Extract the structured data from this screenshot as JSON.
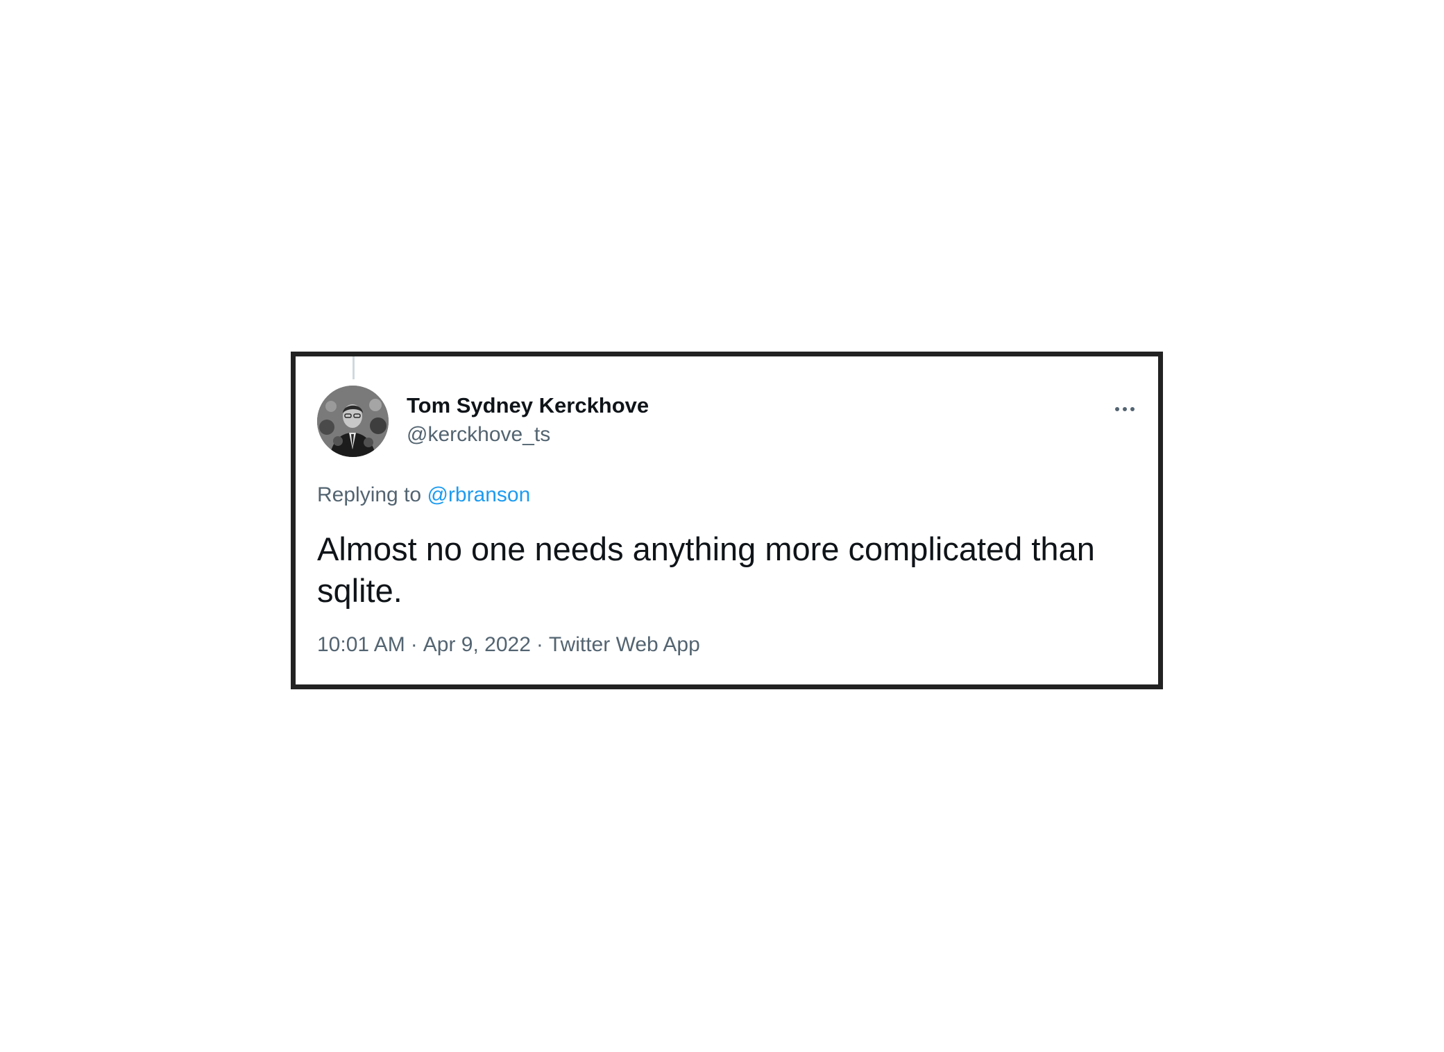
{
  "tweet": {
    "author": {
      "display_name": "Tom Sydney Kerckhove",
      "handle": "@kerckhove_ts"
    },
    "reply": {
      "prefix": "Replying to",
      "mention": "@rbranson"
    },
    "text": "Almost no one needs anything more complicated than sqlite.",
    "meta": {
      "time": "10:01 AM",
      "separator": "·",
      "date": "Apr 9, 2022",
      "source": "Twitter Web App"
    },
    "icons": {
      "more": "more-horizontal-icon",
      "avatar": "profile-photo"
    },
    "colors": {
      "border": "#222222",
      "link": "#1d9bf0",
      "secondary_text": "#536471",
      "primary_text": "#0f1419",
      "thread_line": "#cfd9de"
    }
  }
}
